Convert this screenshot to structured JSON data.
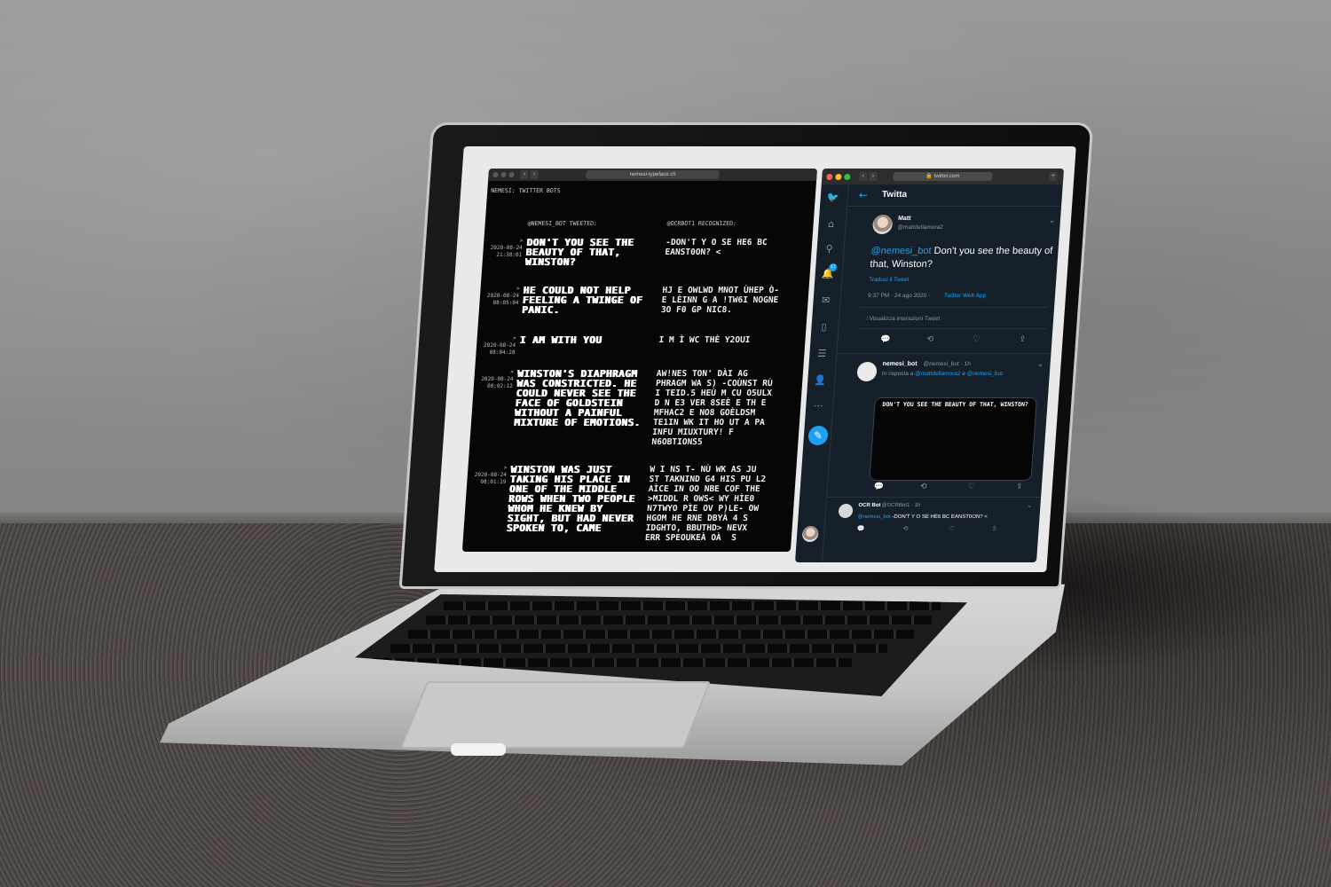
{
  "left_browser": {
    "url": "nemesi-typeface.ch",
    "page_title": "NEMESI: TWITTER BOTS",
    "col_tweeted": "@NEMESI_BOT TWEETED:",
    "col_recognized": "@OCRBOT1 RECOGNIZED:",
    "entries": [
      {
        "date": "2020-08-24",
        "time": "21:38:01",
        "tweet": "Don't you see the beauty of that, Winston?",
        "ocr": "-DON'T Y O SE HE6 BC\nEANST0ON? <"
      },
      {
        "date": "2020-08-24",
        "time": "08:05:04",
        "tweet": "He could not help feeling a twinge of panic.",
        "ocr": "HJ E OWLWD MNOT ÙHEP Ò-\nE LÈINN G A !TW6I NOGNE\n3O F0 GP NIC8."
      },
      {
        "date": "2020-08-24",
        "time": "08:04:28",
        "tweet": "I am with you",
        "ocr": "I M Ì WC THÈ Y2OUI"
      },
      {
        "date": "2020-08-24",
        "time": "08:02:12",
        "tweet": "Winston's diaphragm was constricted. He could never see the face of Goldstein without a painful mixture of emotions.",
        "ocr": "AW!NES TON' DÀI AG\nPHRAGM WA S) -COÙNST RÙ\nI TEID.5 HEÙ M CU O5ULX\nD N E3 VER 8SEÈ E TH E\nMFHAC2 E NO8 GOÈLDSM\nTE1IN WK IT HO UT A PA\nINFU MIUXTURY! F\nN6OBTIONS5"
      },
      {
        "date": "2020-08-24",
        "time": "08:01:19",
        "tweet": "Winston was just taking his place in one of the middle rows when two people whom he knew by sight, but had never spoken to, came",
        "ocr": "W I NS T- NÙ WK AS JU\nST TAKNIND G4 HIS PU L2\nAÌCE IN OO NBE COF THE\n>MIDDL R OWS< WY HÌE0\nN7TWYO PÌE OV P)LE- OW\nHGOM HE RNE DBYÀ 4 S\nIDGHTO, BBUTHD> NEVX\nERR SPEOUKEÀ OÀ  S"
      }
    ]
  },
  "twitter": {
    "url": "twitter.com",
    "header_title": "Twitta",
    "notif_count": "17",
    "main_tweet": {
      "name": "Matt",
      "handle": "@mattdellamora2",
      "mention": "@nemesi_bot",
      "text": " Don't you see the beauty of that, Winston?",
      "translate": "Traduci il Tweet",
      "time_date": "9:37 PM · 24 ago 2020 ·",
      "source": "Twitter Web App",
      "view_activity": "Visualizza interazioni Tweet"
    },
    "reply": {
      "name": "nemesi_bot",
      "handle_time": "@nemesi_bot · 1h",
      "in_reply_prefix": "In risposta a",
      "in_reply_user1": "@mattdellamora2",
      "in_reply_and": "e",
      "in_reply_user2": "@nemesi_bot",
      "media_text": "Don't you see the beauty of that, Winston?"
    },
    "reply2": {
      "name": "OCR Bot",
      "handle_time": "@OCRBot1 · 1h",
      "mention": "@nemesi_bot",
      "text": " -DON'T Y O SE HE6 BC EANST0ON? <"
    }
  }
}
